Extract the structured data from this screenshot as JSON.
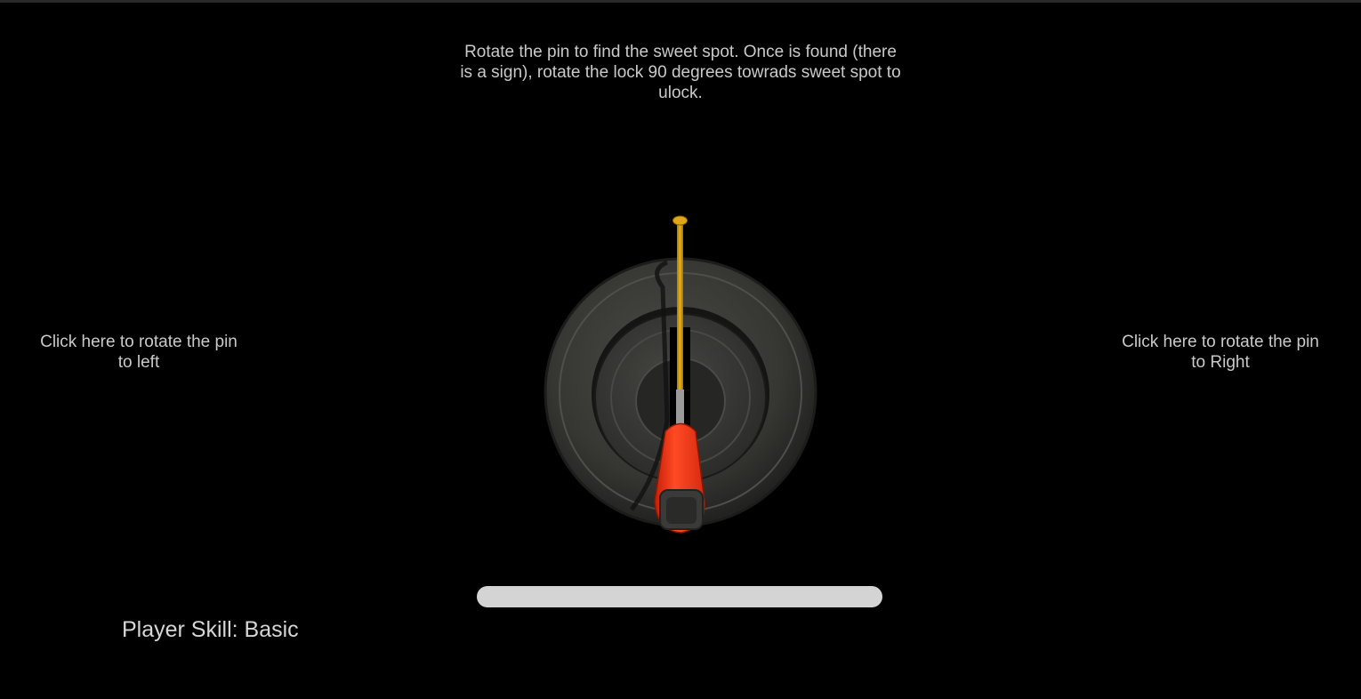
{
  "instructions": "Rotate the pin to find the sweet spot. Once is found (there is a sign), rotate the lock 90 degrees towrads sweet spot to ulock.",
  "controls": {
    "rotate_left_label": "Click here to rotate the pin to left",
    "rotate_right_label": "Click here to rotate the pin to Right"
  },
  "player": {
    "skill_prefix": "Player Skill: ",
    "skill_level": "Basic"
  },
  "progress": {
    "value": 0
  },
  "colors": {
    "background": "#000000",
    "text": "#c9c9c9",
    "lock_ring": "#3a3a38",
    "pin": "#d4a017",
    "screwdriver_handle": "#ff3a1a",
    "progress_track": "#d4d4d4"
  }
}
